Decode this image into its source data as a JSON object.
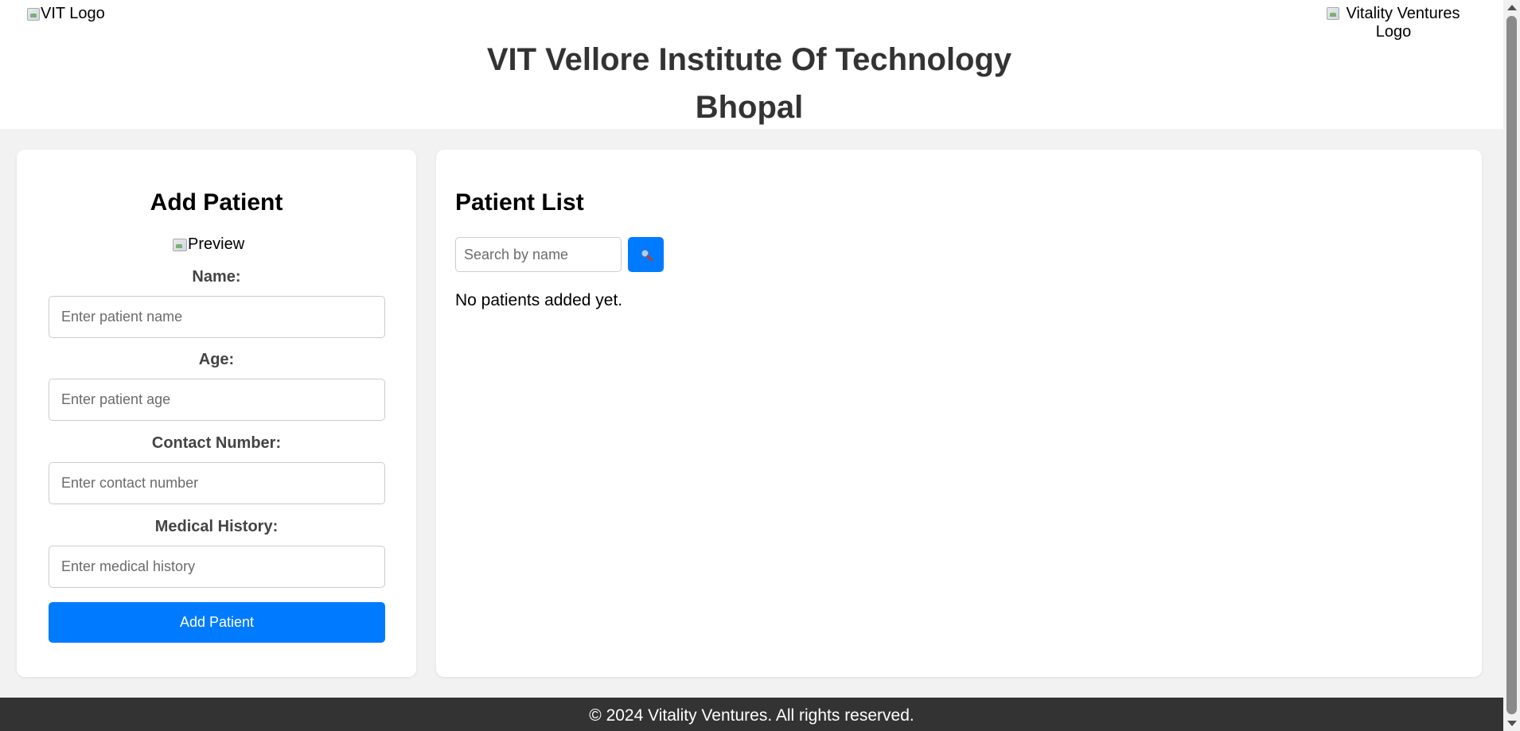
{
  "header": {
    "left_logo_alt": "VIT Logo",
    "title_line1": "VIT Vellore Institute Of Technology",
    "title_line2": "Bhopal",
    "right_logo_alt": "Vitality Ventures Logo"
  },
  "add_patient": {
    "title": "Add Patient",
    "preview_alt": "Preview",
    "fields": [
      {
        "label": "Name:",
        "placeholder": "Enter patient name",
        "value": ""
      },
      {
        "label": "Age:",
        "placeholder": "Enter patient age",
        "value": ""
      },
      {
        "label": "Contact Number:",
        "placeholder": "Enter contact number",
        "value": ""
      },
      {
        "label": "Medical History:",
        "placeholder": "Enter medical history",
        "value": ""
      }
    ],
    "submit_label": "Add Patient"
  },
  "patient_list": {
    "title": "Patient List",
    "search_placeholder": "Search by name",
    "search_icon": "search-icon",
    "empty_message": "No patients added yet."
  },
  "footer": {
    "text": "© 2024 Vitality Ventures. All rights reserved."
  },
  "colors": {
    "accent": "#007bff",
    "footer_bg": "#333333",
    "page_bg": "#f2f2f2",
    "heading_text": "#333333"
  }
}
